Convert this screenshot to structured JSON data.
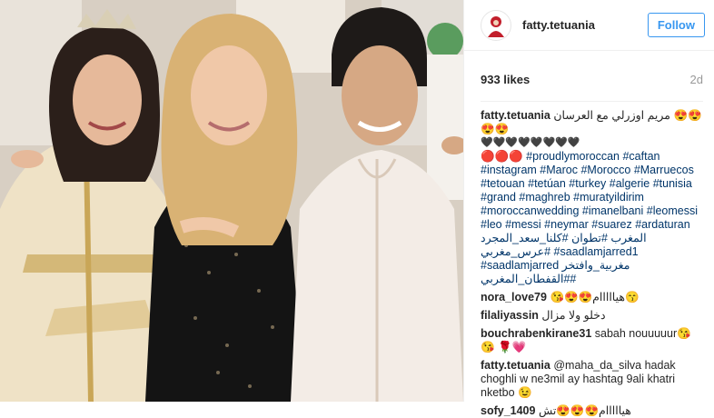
{
  "post": {
    "username": "fatty.tetuania",
    "follow_label": "Follow",
    "likes": "933 likes",
    "age": "2d",
    "caption": {
      "user": "fatty.tetuania",
      "text": "مريم اوزرلي مع العرسان 😍😍😍😍",
      "hearts": "🖤🖤🖤🖤🖤🖤🖤🖤",
      "tags": "🔴🔴🔴 #proudlymoroccan #caftan #instagram #Maroc #Morocco #Marruecos #tetouan #tetúan #turkey #algerie #tunisia #grand #maghreb #muratyildirim #moroccanwedding #imanelbani #leomessi #leo #messi #neymar #suarez #ardaturan المغرب #تطوان #كلنا_سعد_المجرد #عرس_مغربي #saadlamjarred1 #saadlamjarred مغربية_وافتخر #القفطان_المغربي#"
    },
    "comments": [
      {
        "user": "nora_love79",
        "text": "😘😍😍هيااااام😙"
      },
      {
        "user": "filaliyassin",
        "text": "دخلو ولا مزال"
      },
      {
        "user": "bouchrabenkirane31",
        "text": "sabah nouuuuur😘😘 🌹💗"
      },
      {
        "user": "fatty.tetuania",
        "text": "@maha_da_silva hadak choghli w ne3mil ay hashtag 9ali khatri nketbo 😉"
      },
      {
        "user": "sofy_1409",
        "text": "هيااااام😍😍😍تش"
      }
    ]
  },
  "colors": {
    "accent": "#3897f0",
    "hashtag": "#003569",
    "muted": "#999999"
  }
}
